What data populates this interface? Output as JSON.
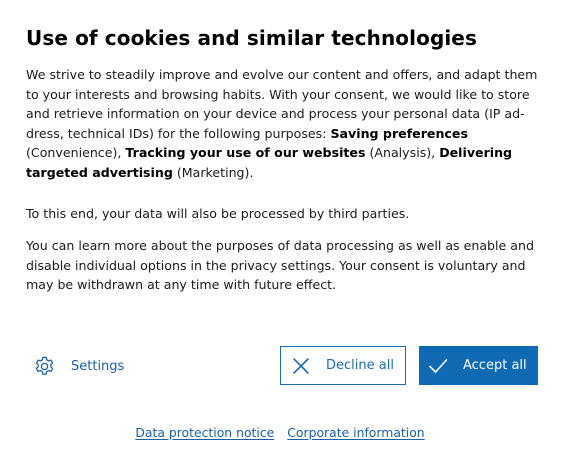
{
  "dialog": {
    "title": "Use of cookies and similar technologies",
    "intro": {
      "text_before": "We strive to steadily improve and evolve our content and offers, and adapt them to your interests and browsing habits. With your consent, we would like to store and retrieve information on your device and process your personal data (IP ad­dress, technical IDs) for the following purposes: ",
      "purpose1": "Saving preferences",
      "purpose1_category": " (Convenience), ",
      "purpose2": "Tracking your use of our websites",
      "purpose2_category": " (Analysis), ",
      "purpose3": "Delivering targeted advertising",
      "purpose3_category": " (Marketing)."
    },
    "third_parties": "To this end, your data will also be processed by third parties.",
    "learn_more": "You can learn more about the purposes of data processing as well as enable and disable individual options in the privacy settings. Your consent is voluntary and may be withdrawn at any time with future effect."
  },
  "actions": {
    "settings_label": "Settings",
    "settings_icon": "gear-icon",
    "decline_label": "Decline all",
    "decline_icon": "close-icon",
    "accept_label": "Accept all",
    "accept_icon": "check-icon"
  },
  "footer": {
    "data_protection": "Data protection notice",
    "corporate_info": "Corporate information"
  },
  "colors": {
    "accent": "#0f6ab4",
    "link": "#1a5fa8",
    "text": "#1a1a1a"
  }
}
